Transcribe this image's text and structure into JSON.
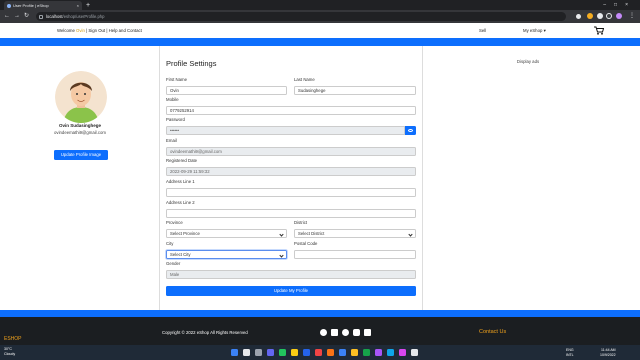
{
  "browser": {
    "tab_title": "User Profile | eShop",
    "tab_close": "×",
    "new_tab": "+",
    "window_controls": "–□×",
    "url_host": "localhost",
    "url_path": "/eshop/userProfile.php"
  },
  "header": {
    "welcome_prefix": "Welcome",
    "user_first_name": "Ovin",
    "links_sep": "| Sign Out | Help and Contact",
    "sell_label": "Sell",
    "myeshop_label": "My eShop"
  },
  "profile": {
    "full_name": "Ovin Sudasinghege",
    "email": "ovindeemathi9@gmail.com",
    "update_image_label": "Update Profile Image"
  },
  "form": {
    "title": "Profile Settings",
    "first_name_label": "First Name",
    "first_name_value": "Ovin",
    "last_name_label": "Last Name",
    "last_name_value": "Sudasinghege",
    "mobile_label": "Mobile",
    "mobile_value": "0779252914",
    "password_label": "Password",
    "password_value": "••••••",
    "email_label": "Email",
    "email_value": "ovindeemathi9@gmail.com",
    "registered_label": "Registered Date",
    "registered_value": "2022-09-29 11:59:32",
    "address1_label": "Address Line 1",
    "address1_value": "",
    "address2_label": "Address Line 2",
    "address2_value": "",
    "province_label": "Province",
    "province_value": "Select Province",
    "district_label": "District",
    "district_value": "Select District",
    "city_label": "City",
    "city_value": "Select City",
    "postal_label": "Postal Code",
    "postal_value": "",
    "gender_label": "Gender",
    "gender_value": "Male",
    "save_label": "Update My Profile"
  },
  "sidebar_right": {
    "ads_label": "Display ads"
  },
  "footer": {
    "copyright": "Copyright © 2022 eShop All Rights Reserved",
    "brand": "ESHOP",
    "contact": "Contact Us"
  },
  "taskbar": {
    "temp": "30°C",
    "condition": "Cloudy",
    "lang1": "ENG",
    "lang2": "INTL",
    "time": "11:44 AM",
    "date": "10/9/2022"
  },
  "colors": {
    "primary": "#0d6efd",
    "footer_bg": "#1b1e21",
    "accent": "#f0a21c"
  }
}
